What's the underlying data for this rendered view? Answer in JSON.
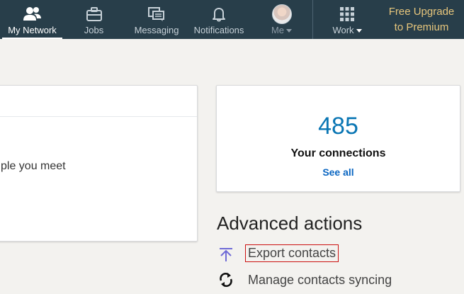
{
  "nav": {
    "items": [
      {
        "label": "My Network",
        "icon": "people-icon",
        "active": true
      },
      {
        "label": "Jobs",
        "icon": "briefcase-icon"
      },
      {
        "label": "Messaging",
        "icon": "messaging-icon"
      },
      {
        "label": "Notifications",
        "icon": "bell-icon"
      },
      {
        "label": "Me",
        "icon": "avatar"
      },
      {
        "label": "Work",
        "icon": "grid-icon"
      }
    ],
    "premium_line1": "Free Upgrade",
    "premium_line2": "to Premium"
  },
  "left_card": {
    "description": "ple you meet"
  },
  "connections": {
    "count": "485",
    "label": "Your connections",
    "see_all": "See all"
  },
  "advanced": {
    "title": "Advanced actions",
    "export_label": "Export contacts",
    "sync_label": "Manage contacts syncing"
  },
  "colors": {
    "nav_bg": "#283e4a",
    "accent": "#0a76b4",
    "premium": "#e7c67c",
    "highlight_box": "#cc1111"
  }
}
